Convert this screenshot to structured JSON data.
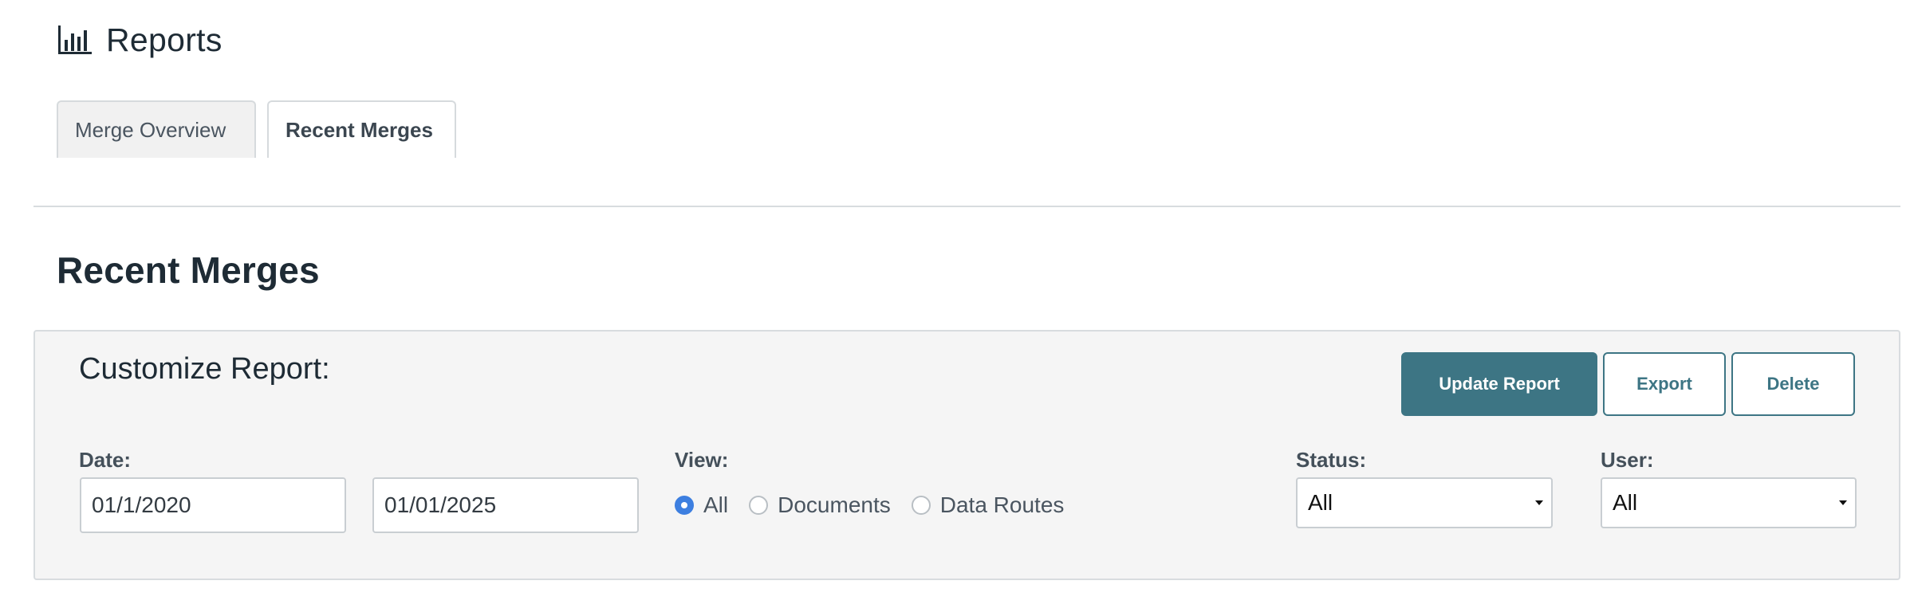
{
  "header": {
    "title": "Reports",
    "icon": "bar-chart-icon"
  },
  "tabs": [
    {
      "label": "Merge Overview",
      "active": false
    },
    {
      "label": "Recent Merges",
      "active": true
    }
  ],
  "section": {
    "title": "Recent Merges"
  },
  "panel": {
    "title": "Customize Report:",
    "buttons": {
      "update": "Update Report",
      "export": "Export",
      "delete": "Delete"
    },
    "date": {
      "label": "Date:",
      "start": "01/1/2020",
      "end": "01/01/2025"
    },
    "view": {
      "label": "View:",
      "options": [
        "All",
        "Documents",
        "Data Routes"
      ],
      "selected": "All"
    },
    "status": {
      "label": "Status:",
      "value": "All"
    },
    "user": {
      "label": "User:",
      "value": "All"
    }
  },
  "colors": {
    "primary": "#3d7584",
    "radio_checked": "#3d7fe0",
    "panel_bg": "#f5f5f5"
  }
}
